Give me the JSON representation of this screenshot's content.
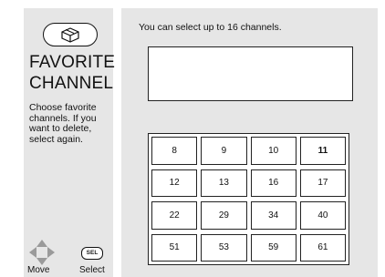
{
  "sidebar": {
    "title_line1": "FAVORITE",
    "title_line2": "CHANNEL",
    "description": "Choose favorite channels.  If you want to delete, select again.",
    "sel_icon_text": "SEL",
    "move_label": "Move",
    "select_label": "Select"
  },
  "main": {
    "instruction": "You can select up to 16 channels.",
    "channels": [
      "8",
      "9",
      "10",
      "11",
      "12",
      "13",
      "16",
      "17",
      "22",
      "29",
      "34",
      "40",
      "51",
      "53",
      "59",
      "61"
    ],
    "highlighted_channel": "11"
  },
  "icons": {
    "top_icon": "remote-box-icon",
    "move_icon": "arrow-cross-icon"
  }
}
